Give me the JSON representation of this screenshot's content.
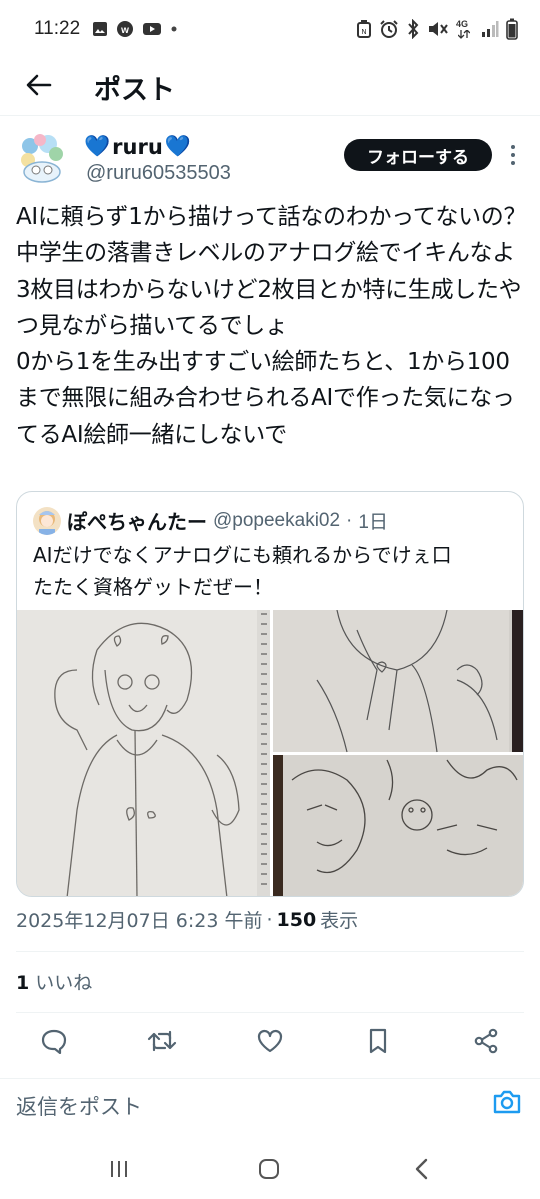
{
  "status_bar": {
    "time": "11:22",
    "network": "4G",
    "left_icons": [
      "image-icon",
      "webtoon-icon",
      "youtube-icon",
      "dot-icon"
    ],
    "right_icons": [
      "nfc-icon",
      "alarm-icon",
      "bluetooth-icon",
      "mute-icon",
      "signal-icon",
      "battery-icon"
    ]
  },
  "header": {
    "title": "ポスト",
    "back_icon": "arrow-left-icon"
  },
  "author": {
    "name": "ruru",
    "name_emoji": "💙",
    "handle": "@ruru60535503",
    "follow_label": "フォローする"
  },
  "tweet": {
    "text": "AIに頼らず1から描けって話なのわかってないの？中学生の落書きレベルのアナログ絵でイキんなよ\n3枚目はわからないけど2枚目とか特に生成したやつ見ながら描いてるでしょ\n0から1を生み出すすごい絵師たちと、1から100まで無限に組み合わせられるAIで作った気になってるAI絵師一緒にしないで"
  },
  "quote": {
    "name": "ぽぺちゃんたー",
    "handle": "@popeekaki02",
    "separator": "·",
    "age": "1日",
    "text": "AIだけでなくアナログにも頼れるからでけぇ口\nたたく資格ゲットだぜー！",
    "media_count": 3
  },
  "meta": {
    "timestamp": "2025年12月07日 6:23 午前",
    "separator": "·",
    "views_count": "150",
    "views_label": "表示"
  },
  "likes": {
    "count": "1",
    "label": "いいね"
  },
  "actions": [
    "reply-icon",
    "retweet-icon",
    "like-icon",
    "bookmark-icon",
    "share-icon"
  ],
  "reply_bar": {
    "placeholder": "返信をポスト",
    "camera_icon": "camera-icon"
  },
  "colors": {
    "accent": "#1d9bf0",
    "text": "#0f1419",
    "secondary": "#536471",
    "border": "#cfd9de"
  },
  "navbar": [
    "recent-apps-icon",
    "home-icon",
    "back-icon"
  ]
}
